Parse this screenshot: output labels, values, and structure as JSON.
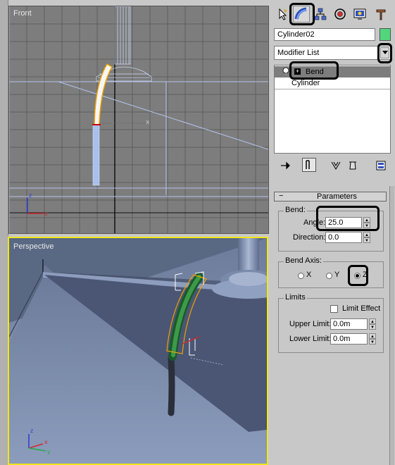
{
  "viewports": {
    "front": {
      "label": "Front"
    },
    "perspective": {
      "label": "Perspective"
    }
  },
  "axis": {
    "x": "x",
    "y": "y",
    "z": "z"
  },
  "command_panel": {
    "tabs": [
      "select-arrow-icon",
      "modify-icon",
      "hierarchy-icon",
      "motion-icon",
      "display-icon",
      "utilities-icon"
    ],
    "object_name": "Cylinder02",
    "object_color": "#52d67c",
    "modifier_list": "Modifier List",
    "stack": {
      "items": [
        {
          "label": "Bend",
          "selected": true,
          "expand": "+"
        },
        {
          "label": "Cylinder",
          "selected": false
        }
      ]
    }
  },
  "rollout": {
    "toggle": "−",
    "title": "Parameters",
    "bend": {
      "group_label": "Bend:",
      "angle_label": "Angle:",
      "angle_value": "25.0",
      "direction_label": "Direction:",
      "direction_value": "0.0"
    },
    "bend_axis": {
      "group_label": "Bend Axis:",
      "options": [
        "X",
        "Y",
        "Z"
      ],
      "selected": "Z"
    },
    "limits": {
      "group_label": "Limits",
      "limit_effect_label": "Limit Effect",
      "limit_effect_checked": false,
      "upper_label": "Upper Limit:",
      "upper_value": "0.0m",
      "lower_label": "Lower Limit:",
      "lower_value": "0.0m"
    }
  }
}
